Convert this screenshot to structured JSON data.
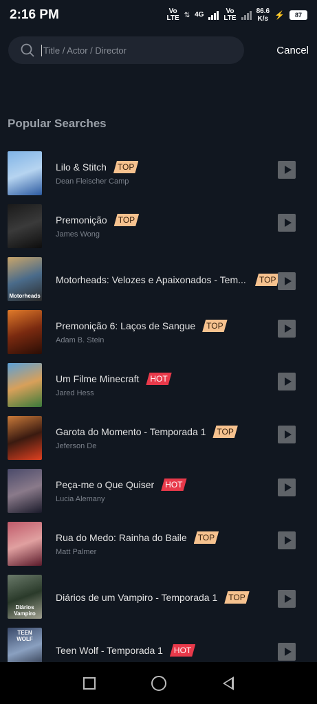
{
  "status": {
    "time": "2:16 PM",
    "sim1_top": "Vo",
    "sim1_bottom": "LTE",
    "net_gen": "4G",
    "sim2_top": "Vo",
    "sim2_bottom": "LTE",
    "speed_value": "86.6",
    "speed_unit": "K/s",
    "battery": "87"
  },
  "search": {
    "placeholder": "Title / Actor / Director",
    "cancel_label": "Cancel"
  },
  "section_title": "Popular Searches",
  "items": [
    {
      "title": "Lilo & Stitch",
      "subtitle": "Dean Fleischer Camp",
      "badge": "TOP",
      "badge_type": "top",
      "poster_colors": [
        "#7fb3e6",
        "#b6d4f0",
        "#2c5aa0"
      ]
    },
    {
      "title": "Premonição",
      "subtitle": "James Wong",
      "badge": "TOP",
      "badge_type": "top",
      "poster_colors": [
        "#1a1a1a",
        "#3a3a3a",
        "#0d0d0d"
      ]
    },
    {
      "title": "Motorheads: Velozes e Apaixonados - Tem...",
      "subtitle": "",
      "badge": "TOP",
      "badge_type": "top",
      "poster_colors": [
        "#c9a56a",
        "#4a6b8a",
        "#2b2b2b"
      ]
    },
    {
      "title": "Premonição 6: Laços de Sangue",
      "subtitle": "Adam B. Stein",
      "badge": "TOP",
      "badge_type": "top",
      "poster_colors": [
        "#e07a2a",
        "#7a2a10",
        "#2a0d05"
      ]
    },
    {
      "title": "Um Filme Minecraft",
      "subtitle": "Jared Hess",
      "badge": "HOT",
      "badge_type": "hot",
      "poster_colors": [
        "#5aa0d8",
        "#d8a05a",
        "#3a7a3a"
      ]
    },
    {
      "title": "Garota do Momento - Temporada 1",
      "subtitle": "Jeferson De",
      "badge": "TOP",
      "badge_type": "top",
      "poster_colors": [
        "#c97a3a",
        "#3a1a10",
        "#e04020"
      ]
    },
    {
      "title": "Peça-me o Que Quiser",
      "subtitle": "Lucia Alemany",
      "badge": "HOT",
      "badge_type": "hot",
      "poster_colors": [
        "#4a4a6a",
        "#8a7a8a",
        "#1a1a2a"
      ]
    },
    {
      "title": "Rua do Medo: Rainha do Baile",
      "subtitle": "Matt Palmer",
      "badge": "TOP",
      "badge_type": "top",
      "poster_colors": [
        "#c05a6a",
        "#e0a0a0",
        "#5a1a2a"
      ]
    },
    {
      "title": "Diários de um Vampiro - Temporada 1",
      "subtitle": "",
      "badge": "TOP",
      "badge_type": "top",
      "poster_colors": [
        "#6a7a6a",
        "#2a3a2a",
        "#a0a090"
      ]
    },
    {
      "title": "Teen Wolf - Temporada 1",
      "subtitle": "",
      "badge": "HOT",
      "badge_type": "hot",
      "poster_colors": [
        "#3a4a6a",
        "#8aa0c0",
        "#1a2030"
      ]
    }
  ],
  "poster_captions": {
    "2": "Motorheads",
    "8": "Diários\nVampiro",
    "9": "TEEN WOLF"
  }
}
